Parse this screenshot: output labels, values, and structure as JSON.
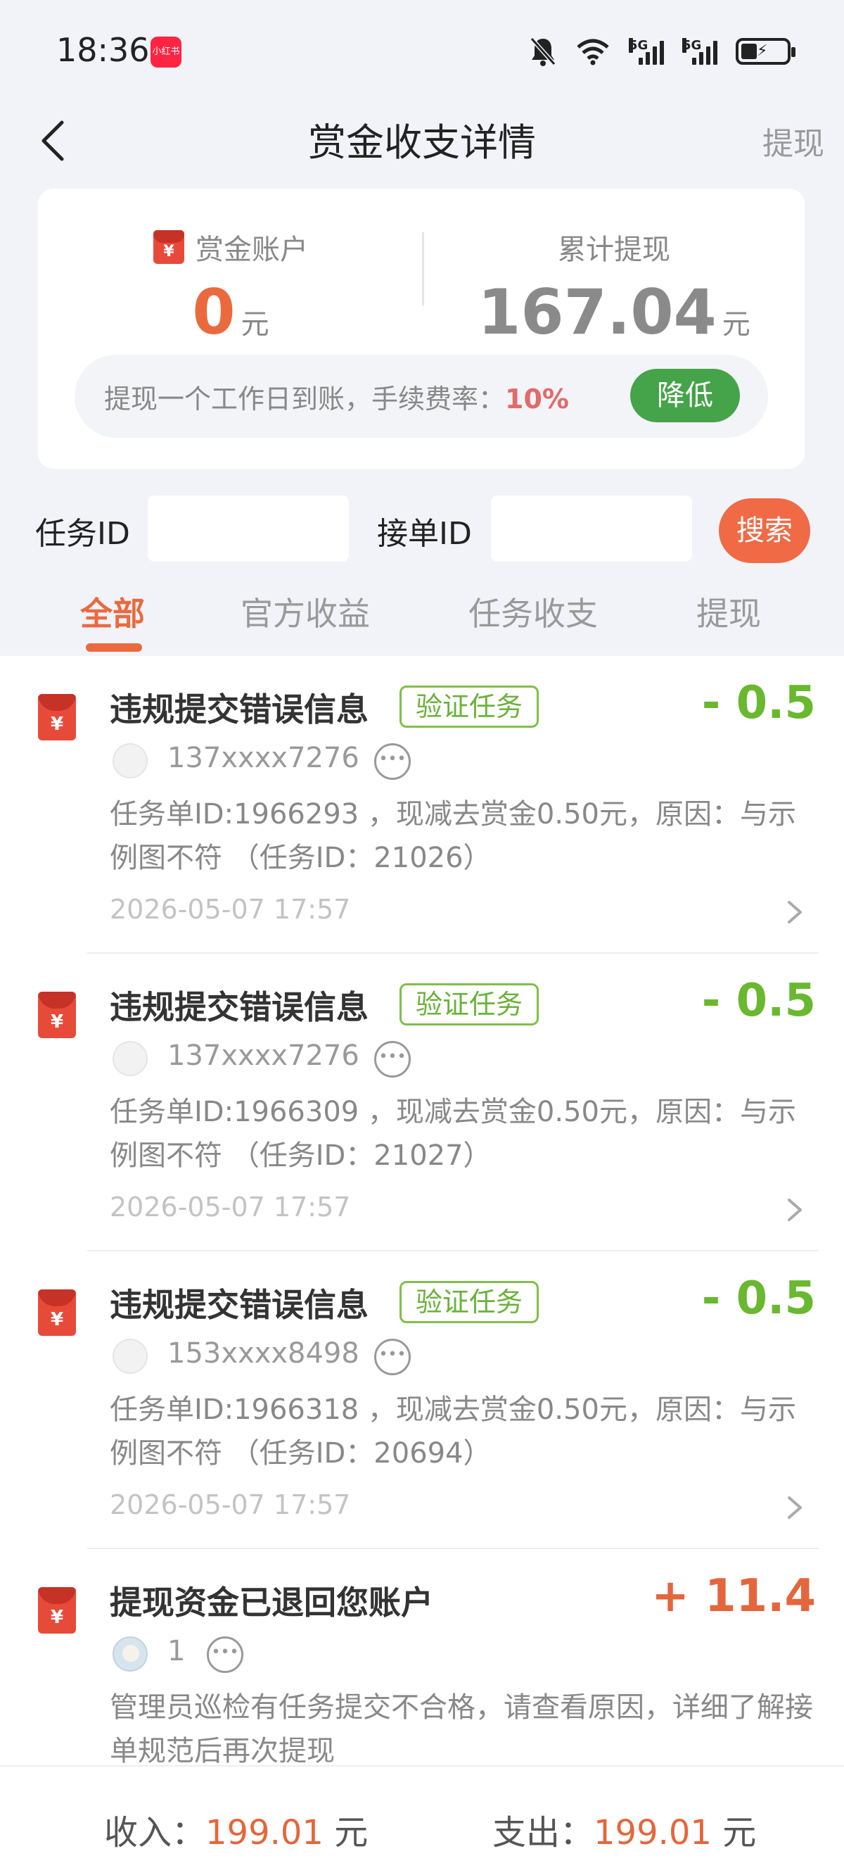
{
  "status_bar": {
    "time": "18:36",
    "app_badge": "小红书",
    "icons": [
      "bell-off-icon",
      "wifi-icon",
      "signal-5g-icon",
      "signal-5g-icon",
      "battery-charging-icon"
    ],
    "net_labels": [
      "5G",
      "5G"
    ]
  },
  "nav": {
    "title": "赏金收支详情",
    "action": "提现"
  },
  "summary": {
    "account_label": "赏金账户",
    "account_value": "0",
    "account_unit": "元",
    "total_label": "累计提现",
    "total_value": "167.04",
    "total_unit": "元",
    "fee_text": "提现一个工作日到账，手续费率：",
    "fee_rate": "10%",
    "reduce_button": "降低"
  },
  "search": {
    "task_id_label": "任务ID",
    "task_id_value": "",
    "order_id_label": "接单ID",
    "order_id_value": "",
    "button": "搜索"
  },
  "tabs": [
    {
      "label": "全部",
      "active": true
    },
    {
      "label": "官方收益",
      "active": false
    },
    {
      "label": "任务收支",
      "active": false
    },
    {
      "label": "提现",
      "active": false
    }
  ],
  "records": [
    {
      "title": "违规提交错误信息",
      "tag": "验证任务",
      "amount": "- 0.5",
      "user": "137xxxx7276",
      "desc": "任务单ID:1966293 ，现减去赏金0.50元，原因：与示例图不符 （任务ID：21026）",
      "time": "2026-05-07 17:57"
    },
    {
      "title": "违规提交错误信息",
      "tag": "验证任务",
      "amount": "- 0.5",
      "user": "137xxxx7276",
      "desc": "任务单ID:1966309 ，现减去赏金0.50元，原因：与示例图不符 （任务ID：21027）",
      "time": "2026-05-07 17:57"
    },
    {
      "title": "违规提交错误信息",
      "tag": "验证任务",
      "amount": "- 0.5",
      "user": "153xxxx8498",
      "desc": "任务单ID:1966318 ，现减去赏金0.50元，原因：与示例图不符 （任务ID：20694）",
      "time": "2026-05-07 17:57"
    },
    {
      "title": "提现资金已退回您账户",
      "tag": "",
      "amount": "+ 11.4",
      "user": "1",
      "desc": "管理员巡检有任务提交不合格，请查看原因，详细了解接单规范后再次提现",
      "time": ""
    }
  ],
  "footer": {
    "income_label": "收入：",
    "income_value": "199.01",
    "income_unit": "元",
    "expense_label": "支出：",
    "expense_value": "199.01",
    "expense_unit": "元"
  },
  "colors": {
    "accent_orange": "#ea6a3e",
    "minus_green": "#69b82f",
    "plus_orange": "#e4663d",
    "reduce_green": "#45a34a",
    "page_bg": "#f1f3f8"
  }
}
